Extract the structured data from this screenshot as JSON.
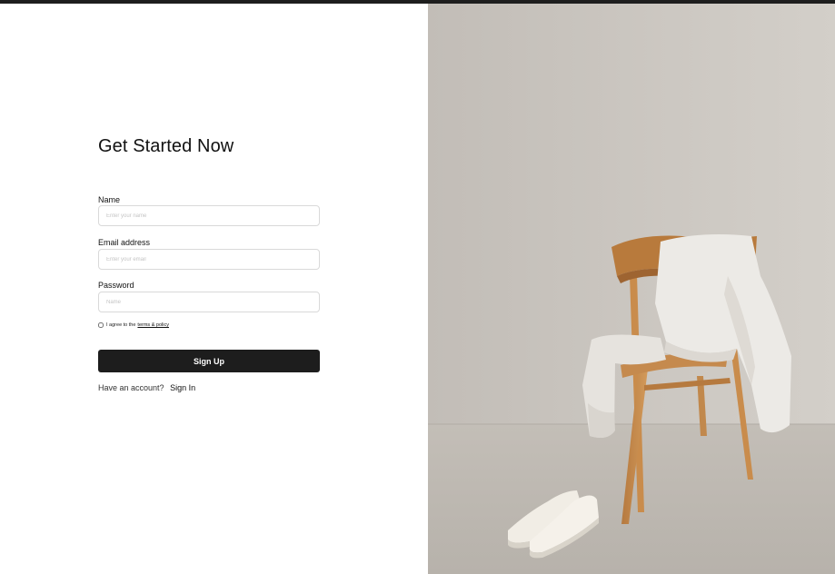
{
  "form": {
    "title": "Get Started Now",
    "name_label": "Name",
    "name_placeholder": "Enter your name",
    "name_value": "",
    "email_label": "Email address",
    "email_placeholder": "Enter your email",
    "email_value": "",
    "password_label": "Password",
    "password_placeholder": "Name",
    "password_value": "",
    "agree_text": "I agree to the",
    "terms_link": "terms & policy",
    "signup_label": "Sign Up",
    "have_account_text": "Have an account?",
    "signin_link": "Sign In"
  },
  "image": {
    "subject": "wooden-chair-with-white-sweatpants-and-sneakers-photo"
  },
  "colors": {
    "button_bg": "#1d1d1d",
    "top_bar": "#1e1e1e",
    "wall": "#cdc9c3",
    "floor": "#bdb8b1"
  }
}
